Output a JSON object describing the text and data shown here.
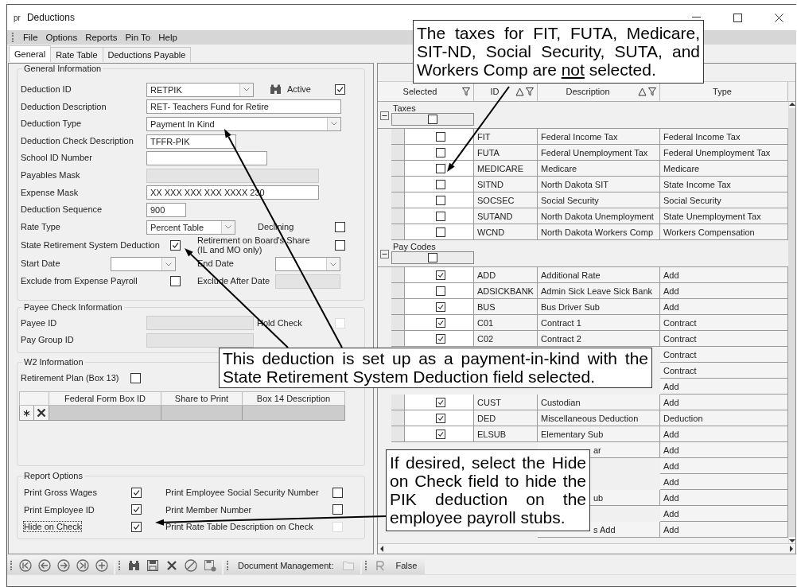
{
  "window": {
    "icon_label": "pr",
    "title": "Deductions"
  },
  "menu": [
    "File",
    "Options",
    "Reports",
    "Pin To",
    "Help"
  ],
  "tabs": [
    {
      "label": "General",
      "selected": true
    },
    {
      "label": "Rate Table",
      "selected": false
    },
    {
      "label": "Deductions Payable",
      "selected": false
    }
  ],
  "general": {
    "title": "General Information",
    "deduction_id": {
      "label": "Deduction ID",
      "value": "RETPIK"
    },
    "active": {
      "label": "Active",
      "checked": true
    },
    "deduction_description": {
      "label": "Deduction Description",
      "value": "RET- Teachers Fund for Retire"
    },
    "deduction_type": {
      "label": "Deduction Type",
      "value": "Payment In Kind"
    },
    "check_description": {
      "label": "Deduction Check Description",
      "value": "TFFR-PIK"
    },
    "school_id": {
      "label": "School ID Number",
      "disabled": false
    },
    "payables_mask": {
      "label": "Payables Mask",
      "disabled": true
    },
    "expense_mask": {
      "label": "Expense Mask",
      "value": "XX XXX XXX XXX XXXX 230",
      "disabled": false
    },
    "sequence": {
      "label": "Deduction Sequence",
      "value": "900"
    },
    "rate_type": {
      "label": "Rate Type",
      "value": "Percent Table"
    },
    "declining": {
      "label": "Declining",
      "checked": false
    },
    "state_retirement": {
      "label": "State Retirement System Deduction",
      "checked": true
    },
    "board_share": {
      "label": "Retirement on Board's Share",
      "note": "(IL and MO only)",
      "checked": false
    },
    "start_date": {
      "label": "Start Date"
    },
    "end_date": {
      "label": "End Date"
    },
    "exclude_expense": {
      "label": "Exclude from Expense Payroll",
      "checked": false
    },
    "exclude_after": {
      "label": "Exclude After Date",
      "disabled": true
    }
  },
  "payee": {
    "title": "Payee Check Information",
    "payee_id": {
      "label": "Payee ID",
      "disabled": true
    },
    "hold_check": {
      "label": "Hold Check",
      "checked": false,
      "disabled": true
    },
    "pay_group_id": {
      "label": "Pay Group ID",
      "disabled": true
    }
  },
  "w2": {
    "title": "W2 Information",
    "retirement_plan": {
      "label": "Retirement Plan (Box 13)",
      "checked": false
    },
    "columns": [
      "Federal Form Box ID",
      "Share to Print",
      "Box 14 Description"
    ]
  },
  "report_options": {
    "title": "Report Options",
    "options": [
      {
        "label": "Print Gross Wages",
        "checked": true,
        "disabled": false,
        "focused": false
      },
      {
        "label": "Print Employee Social Security Number",
        "checked": false,
        "disabled": false,
        "focused": false
      },
      {
        "label": "Print Employee ID",
        "checked": true,
        "disabled": false,
        "focused": false
      },
      {
        "label": "Print Member Number",
        "checked": false,
        "disabled": false,
        "focused": false
      },
      {
        "label": "Hide on Check",
        "checked": true,
        "disabled": false,
        "focused": true
      },
      {
        "label": "Print Rate Table Description on Check",
        "checked": false,
        "disabled": true,
        "focused": false
      }
    ]
  },
  "grid": {
    "columns": [
      {
        "label": "Selected",
        "sort": false,
        "filter": true
      },
      {
        "label": "ID",
        "sort": true,
        "filter": true
      },
      {
        "label": "Description",
        "sort": true,
        "filter": true
      },
      {
        "label": "Type",
        "sort": false,
        "filter": false
      }
    ],
    "groups": [
      {
        "label": "Taxes",
        "expanded": true,
        "all_checked": false,
        "rows": [
          {
            "id": "FIT",
            "description": "Federal Income Tax",
            "type": "Federal Income Tax",
            "checked": false
          },
          {
            "id": "FUTA",
            "description": "Federal Unemployment Tax",
            "type": "Federal Unemployment Tax",
            "checked": false
          },
          {
            "id": "MEDICARE",
            "description": "Medicare",
            "type": "Medicare",
            "checked": false
          },
          {
            "id": "SITND",
            "description": "North Dakota SIT",
            "type": "State Income Tax",
            "checked": false
          },
          {
            "id": "SOCSEC",
            "description": "Social Security",
            "type": "Social Security",
            "checked": false
          },
          {
            "id": "SUTAND",
            "description": "North Dakota Unemployment",
            "type": "State Unemployment Tax",
            "checked": false
          },
          {
            "id": "WCND",
            "description": "North Dakota Workers Comp",
            "type": "Workers Compensation",
            "checked": false
          }
        ]
      },
      {
        "label": "Pay Codes",
        "expanded": true,
        "all_checked": false,
        "rows": [
          {
            "id": "ADD",
            "description": "Additional Rate",
            "type": "Add",
            "checked": true
          },
          {
            "id": "ADSICKBANK",
            "description": "Admin Sick Leave Sick Bank",
            "type": "Add",
            "checked": false
          },
          {
            "id": "BUS",
            "description": "Bus Driver Sub",
            "type": "Add",
            "checked": true
          },
          {
            "id": "C01",
            "description": "Contract 1",
            "type": "Contract",
            "checked": true
          },
          {
            "id": "C02",
            "description": "Contract 2",
            "type": "Contract",
            "checked": true
          },
          {
            "type": "Contract"
          },
          {
            "type": "Contract"
          },
          {
            "type": "Add"
          },
          {
            "id": "CUST",
            "description": "Custodian",
            "type": "Add",
            "checked": true
          },
          {
            "id": "DED",
            "description": "Miscellaneous Deduction",
            "type": "Deduction",
            "checked": true
          },
          {
            "id": "ELSUB",
            "description": "Elementary Sub",
            "type": "Add",
            "checked": true
          },
          {
            "description": "ar",
            "cut": true,
            "type": "Add"
          },
          {
            "type": "Add"
          },
          {
            "type": "Add"
          },
          {
            "description": "ub",
            "cut": true,
            "type": "Add"
          },
          {
            "type": "Add"
          },
          {
            "description": "s Add",
            "cut": true,
            "type": "Add"
          }
        ]
      }
    ]
  },
  "toolbar": {
    "document_label": "Document Management:",
    "status_value": "False"
  },
  "callouts": [
    {
      "parts": [
        {
          "text": "The taxes for FIT, FUTA, Medicare, SIT-ND, Social Security, SUTA, and Workers Comp are "
        },
        {
          "text": "not",
          "underline": true
        },
        {
          "text": " selected."
        }
      ]
    },
    {
      "parts": [
        {
          "text": "This deduction is set up as a payment-in-kind with the State Retirement System Deduction field selected."
        }
      ]
    },
    {
      "parts": [
        {
          "text": "If desired, select the Hide on Check field to hide the PIK deduction on the employee payroll stubs."
        }
      ]
    }
  ]
}
